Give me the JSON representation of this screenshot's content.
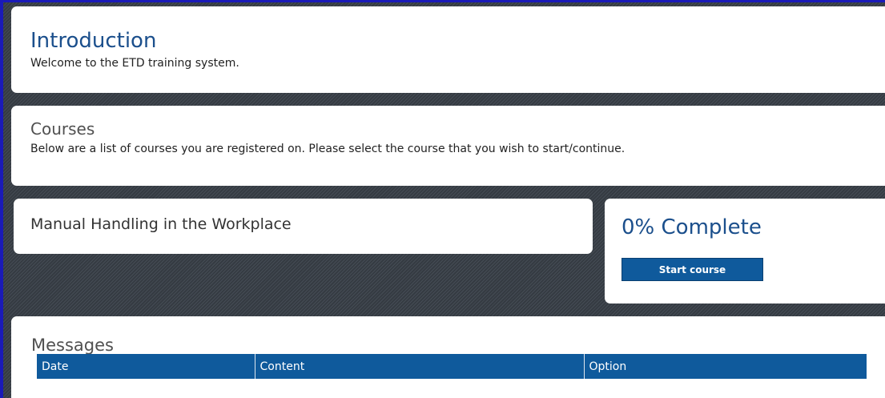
{
  "intro": {
    "title": "Introduction",
    "subtitle": "Welcome to the ETD training system."
  },
  "courses": {
    "title": "Courses",
    "description": "Below are a list of courses you are registered on. Please select the course that you wish to start/continue."
  },
  "course": {
    "name": "Manual Handling in the Workplace",
    "progress_label": "0% Complete",
    "progress_percent": 0,
    "start_label": "Start course"
  },
  "messages": {
    "title": "Messages",
    "columns": [
      "Date",
      "Content",
      "Option"
    ]
  },
  "colors": {
    "accent": "#0f5a9c",
    "heading_blue": "#1b4f8c",
    "frame_border": "#1a1ab8"
  }
}
